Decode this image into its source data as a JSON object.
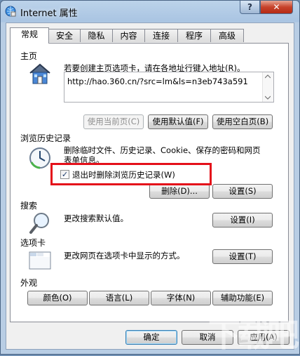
{
  "window": {
    "title": "Internet 属性",
    "help_label": "?",
    "close_label": "✕"
  },
  "tabs": [
    "常规",
    "安全",
    "隐私",
    "内容",
    "连接",
    "程序",
    "高级"
  ],
  "home": {
    "section": "主页",
    "description": "若要创建主页选项卡，请在各地址行键入地址(R)。",
    "url": "http://hao.360.cn/?src=lm&ls=n3eb743a591",
    "use_current": "使用当前页(C)",
    "use_default": "使用默认值(F)",
    "use_blank": "使用空白页(B)"
  },
  "history": {
    "section": "浏览历史记录",
    "description": "删除临时文件、历史记录、Cookie、保存的密码和网页表单信息。",
    "checkbox_label": "退出时删除浏览历史记录(W)",
    "checkbox_checked": true,
    "delete_label": "删除(D)...",
    "settings_label": "设置(S)"
  },
  "search": {
    "section": "搜索",
    "description": "更改搜索默认值。",
    "settings_label": "设置(I)"
  },
  "tabs_section": {
    "section": "选项卡",
    "description": "更改网页在选项卡中显示的方式。",
    "settings_label": "设置(T)"
  },
  "appearance": {
    "section": "外观",
    "colors": "颜色(O)",
    "languages": "语言(L)",
    "fonts": "字体(N)",
    "accessibility": "辅助功能(E)"
  },
  "footer": {
    "ok": "确定",
    "cancel": "取消",
    "apply": "应用(A)"
  },
  "watermark": "下载吧"
}
